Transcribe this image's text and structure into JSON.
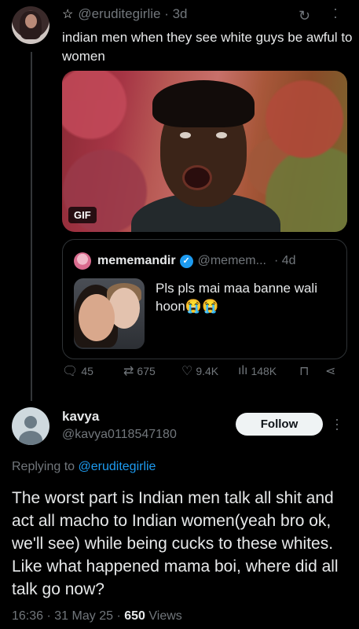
{
  "parent_tweet": {
    "handle": "@eruditegirlie",
    "time": "3d",
    "text": "indian men when they see white guys be awful to women",
    "gif_label": "GIF",
    "quoted": {
      "name": "mememandir",
      "handle": "@memem...",
      "time": "4d",
      "text": "Pls pls mai maa banne wali hoon😭😭"
    },
    "actions": {
      "replies": "45",
      "retweets": "675",
      "likes": "9.4K",
      "views": "148K"
    }
  },
  "reply": {
    "name": "kavya",
    "handle": "@kavya0118547180",
    "follow_label": "Follow",
    "replying_prefix": "Replying to",
    "replying_to": "@eruditegirlie",
    "text": "The worst part is Indian men talk all shit and act all macho to Indian women(yeah bro ok, we'll see) while being cucks to these whites. Like what happened mama boi, where did all talk go now?",
    "time": "16:36",
    "date": "31 May 25",
    "views_count": "650",
    "views_label": "Views"
  },
  "icons": {
    "star": "☆",
    "sync": "↻",
    "more": "⋮",
    "reply": "💬",
    "retweet": "⇄",
    "like": "♡",
    "views": "📊",
    "bookmark": "🔖",
    "share": "⤴"
  },
  "colors": {
    "accent": "#1d9bf0",
    "secondary_text": "#71767b",
    "primary_text": "#e7e9ea",
    "background": "#000000"
  }
}
